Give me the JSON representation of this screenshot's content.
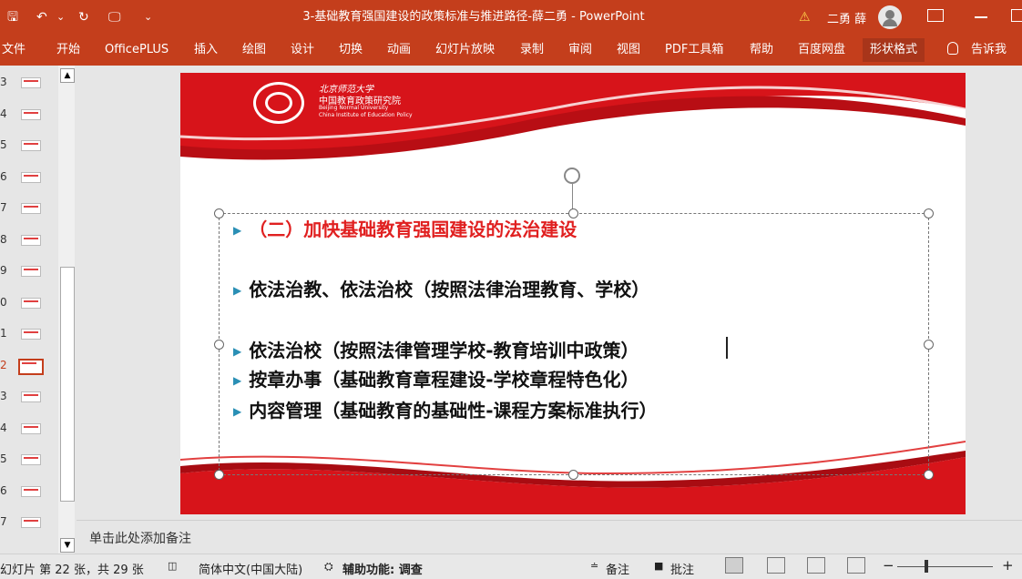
{
  "window": {
    "title": "3-基础教育强国建设的政策标准与推进路径-薛二勇  -  PowerPoint",
    "user": "二勇 薛",
    "quick_access": {
      "save": "🖫",
      "undo": "↶",
      "undo_dropdown": "⌄",
      "redo": "↻",
      "present": "🖵",
      "customize": "⌄"
    }
  },
  "tabs": [
    "文件",
    "开始",
    "OfficePLUS",
    "插入",
    "绘图",
    "设计",
    "切换",
    "动画",
    "幻灯片放映",
    "录制",
    "审阅",
    "视图",
    "PDF工具箱",
    "帮助",
    "百度网盘",
    "形状格式",
    "告诉我"
  ],
  "active_tab": "形状格式",
  "thumbnails": {
    "numbers": [
      "3",
      "4",
      "5",
      "6",
      "7",
      "8",
      "9",
      "0",
      "1",
      "2",
      "3",
      "4",
      "5",
      "6",
      "7"
    ],
    "selected_index": 9
  },
  "slide": {
    "logo": {
      "university": "北京师范大学",
      "institute": "中国教育政策研究院",
      "en_line1": "Beijing Normal University",
      "en_line2": "China Institute of Education Policy"
    },
    "heading": "（二）加快基础教育强国建设的法治建设",
    "bullets": [
      "依法治教、依法治校（按照法律治理教育、学校）",
      "依法治校（按照法律管理学校-教育培训中政策）",
      "按章办事（基础教育章程建设-学校章程特色化）",
      "内容管理（基础教育的基础性-课程方案标准执行）"
    ]
  },
  "notes_placeholder": "单击此处添加备注",
  "status": {
    "slide_info": "幻灯片 第 22 张，共 29 张",
    "language": "简体中文(中国大陆)",
    "accessibility": "辅助功能: 调查",
    "notes_btn": "备注",
    "comments_btn": "批注",
    "zoom_minus": "−",
    "zoom_plus": "+",
    "zoom_level": 0.3
  },
  "colors": {
    "accent": "#c43e1c",
    "heading_red": "#e02020",
    "bullet_teal": "#2a8fb5"
  }
}
